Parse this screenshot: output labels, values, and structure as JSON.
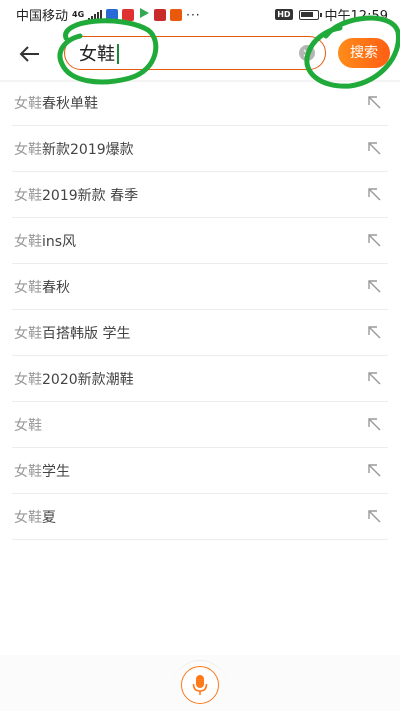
{
  "status_bar": {
    "carrier": "中国移动",
    "network": "4G",
    "hd_badge": "HD",
    "time": "中午12:59",
    "battery_level": 0.85,
    "notification_icons": [
      "app-icon-blue",
      "app-icon-red",
      "play-icon",
      "app-icon-red-square",
      "app-icon-red-badge"
    ],
    "more_indicator": "···"
  },
  "search": {
    "query": "女鞋",
    "search_button_label": "搜索",
    "accent_color": "#e8590c",
    "button_gradient": [
      "#ff8c1a",
      "#ff5e14"
    ]
  },
  "suggestions": [
    {
      "keyword": "女鞋",
      "suffix": "春秋单鞋"
    },
    {
      "keyword": "女鞋",
      "suffix": "新款2019爆款"
    },
    {
      "keyword": "女鞋",
      "suffix": "2019新款 春季"
    },
    {
      "keyword": "女鞋",
      "suffix": "ins风"
    },
    {
      "keyword": "女鞋",
      "suffix": "春秋"
    },
    {
      "keyword": "女鞋",
      "suffix": "百搭韩版 学生"
    },
    {
      "keyword": "女鞋",
      "suffix": "2020新款潮鞋"
    },
    {
      "keyword": "女鞋",
      "suffix": ""
    },
    {
      "keyword": "女鞋",
      "suffix": "学生"
    },
    {
      "keyword": "女鞋",
      "suffix": "夏"
    }
  ],
  "voice": {
    "icon": "microphone-icon",
    "color": "#ff7a1a"
  },
  "annotation_color": "#1faa3a"
}
